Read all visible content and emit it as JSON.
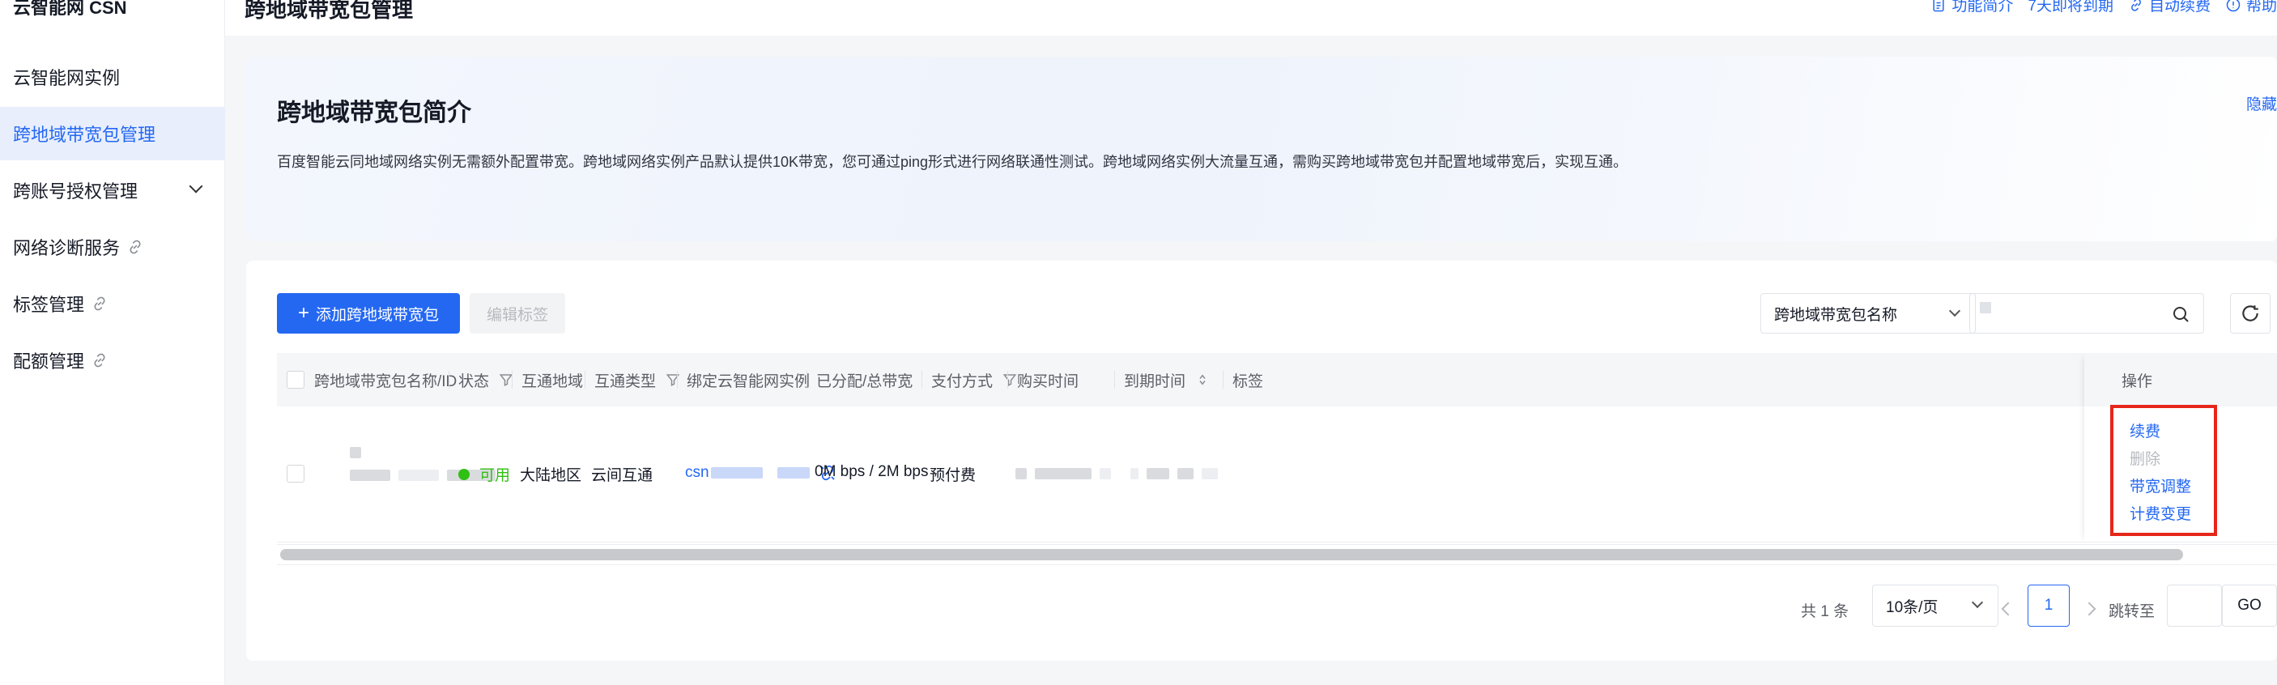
{
  "app": {
    "brand": "云智能网 CSN",
    "page_title": "跨地域带宽包管理"
  },
  "sidebar": {
    "items": [
      {
        "label": "云智能网实例",
        "active": false
      },
      {
        "label": "跨地域带宽包管理",
        "active": true
      },
      {
        "label": "跨账号授权管理",
        "expandable": true
      },
      {
        "label": "网络诊断服务",
        "external": true
      },
      {
        "label": "标签管理",
        "external": true
      },
      {
        "label": "配额管理",
        "external": true
      }
    ]
  },
  "top_links": {
    "intro": "功能简介",
    "expiring": "7天即将到期",
    "auto_renew": "自动续费",
    "help": "帮助"
  },
  "intro": {
    "title": "跨地域带宽包简介",
    "description": "百度智能云同地域网络实例无需额外配置带宽。跨地域网络实例产品默认提供10K带宽，您可通过ping形式进行网络联通性测试。跨地域网络实例大流量互通，需购买跨地域带宽包并配置地域带宽后，实现互通。",
    "hide": "隐藏"
  },
  "toolbar": {
    "add_button": "添加跨地域带宽包",
    "edit_tags": "编辑标签",
    "search_field": "跨地域带宽包名称"
  },
  "table": {
    "headers": {
      "name": "跨地域带宽包名称/ID",
      "status": "状态",
      "region": "互通地域",
      "type": "互通类型",
      "instance": "绑定云智能网实例",
      "bandwidth": "已分配/总带宽",
      "payment": "支付方式",
      "purchase_time": "购买时间",
      "expire_time": "到期时间",
      "tags": "标签",
      "actions": "操作"
    },
    "row": {
      "status": "可用",
      "region": "大陆地区",
      "type": "云间互通",
      "instance_prefix": "csn",
      "bandwidth": "0M bps / 2M bps",
      "payment": "预付费"
    },
    "actions": {
      "renew": "续费",
      "delete": "删除",
      "adjust": "带宽调整",
      "billing": "计费变更"
    }
  },
  "pagination": {
    "total": "共 1 条",
    "page_size": "10条/页",
    "current": "1",
    "jump_label": "跳转至",
    "go": "GO"
  },
  "colors": {
    "accent": "#2468f2",
    "success": "#30bf13",
    "highlight": "#e6261a"
  }
}
